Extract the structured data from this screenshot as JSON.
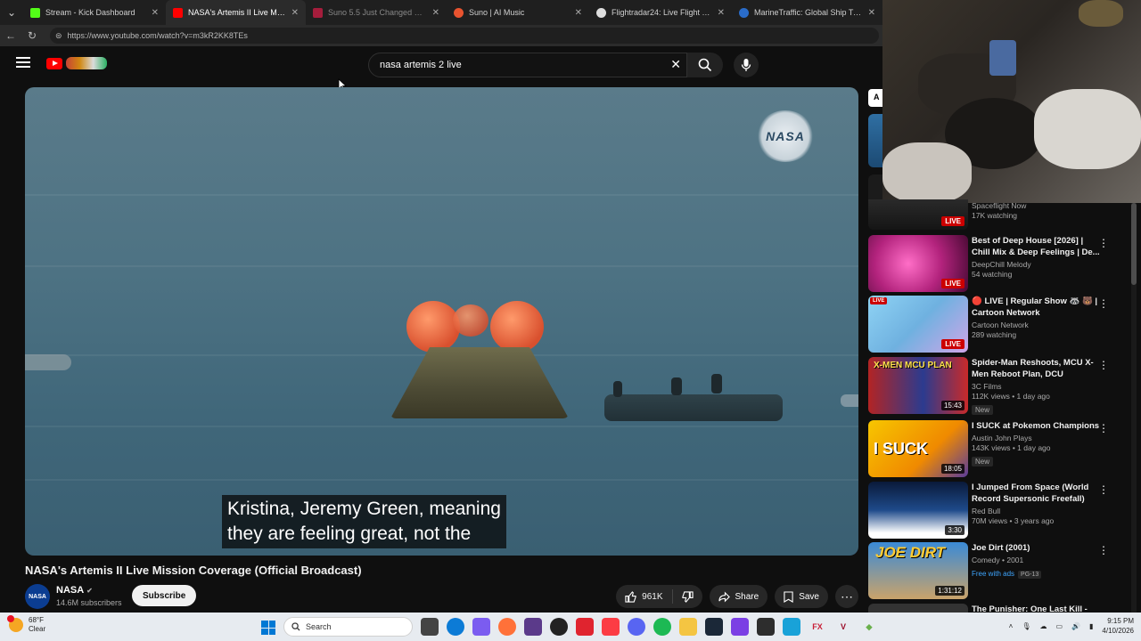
{
  "browser": {
    "tabs": [
      {
        "title": "Stream - Kick Dashboard",
        "color": "#53fc18",
        "active": false
      },
      {
        "title": "NASA's Artemis II Live Missio",
        "color": "#ff0000",
        "active": true
      },
      {
        "title": "Suno 5.5 Just Changed Everything",
        "color": "#a51d3c",
        "active": false
      },
      {
        "title": "Suno | AI Music",
        "color": "#e8532f",
        "active": false
      },
      {
        "title": "Flightradar24: Live Flight Tracker -",
        "color": "#dddddd",
        "active": false
      },
      {
        "title": "MarineTraffic: Global Ship Tracking",
        "color": "#2a6cc9",
        "active": false
      }
    ],
    "url": "https://www.youtube.com/watch?v=m3kR2KK8TEs"
  },
  "header": {
    "search_value": "nasa artemis 2 live"
  },
  "player": {
    "watermark": "NASA",
    "captions_line1": "Kristina, Jeremy Green, meaning",
    "captions_line2": "they are feeling great, not the"
  },
  "video": {
    "title": "NASA's Artemis II Live Mission Coverage (Official Broadcast)",
    "channel": "NASA",
    "channel_avatar_text": "NASA",
    "subscribers": "14.6M subscribers",
    "subscribe_label": "Subscribe",
    "likes": "961K",
    "share_label": "Share",
    "save_label": "Save"
  },
  "sidebar": {
    "partial_top": {
      "channel": "Spaceflight Now",
      "views": "17K watching",
      "badge": "LIVE"
    },
    "items": [
      {
        "title": "Best of Deep House [2026] | Chill Mix & Deep Feelings | De...",
        "channel": "DeepChill Melody",
        "views": "54 watching",
        "badge": "LIVE",
        "thumb_text": ""
      },
      {
        "title": "🔴 LIVE | Regular Show 🦝 🐻 | Cartoon Network",
        "channel": "Cartoon Network",
        "views": "289 watching",
        "badge": "LIVE",
        "thumb_text": ""
      },
      {
        "title": "Spider-Man Reshoots, MCU X-Men Reboot Plan, DCU Update...",
        "channel": "3C Films",
        "views": "112K views • 1 day ago",
        "badge": "15:43",
        "tag": "New",
        "thumb_text": "X-MEN MCU PLAN"
      },
      {
        "title": "I SUCK at Pokemon Champions",
        "channel": "Austin John Plays",
        "views": "143K views • 1 day ago",
        "badge": "18:05",
        "tag": "New",
        "thumb_text": "I SUCK"
      },
      {
        "title": "I Jumped From Space (World Record Supersonic Freefall)",
        "channel": "Red Bull",
        "views": "70M views • 3 years ago",
        "badge": "3:30",
        "thumb_text": ""
      },
      {
        "title": "Joe Dirt (2001)",
        "channel": "Comedy • 2001",
        "views": "",
        "badge": "1:31:12",
        "free": "Free with ads",
        "rating": "PG-13",
        "thumb_text": "JOE DIRT"
      },
      {
        "title": "The Punisher: One Last Kill -",
        "channel": "",
        "views": "",
        "badge": "",
        "thumb_text": ""
      }
    ]
  },
  "taskbar": {
    "temp": "68°F",
    "weather": "Clear",
    "search_placeholder": "Search",
    "time": "9:15 PM",
    "date": "4/10/2026"
  }
}
